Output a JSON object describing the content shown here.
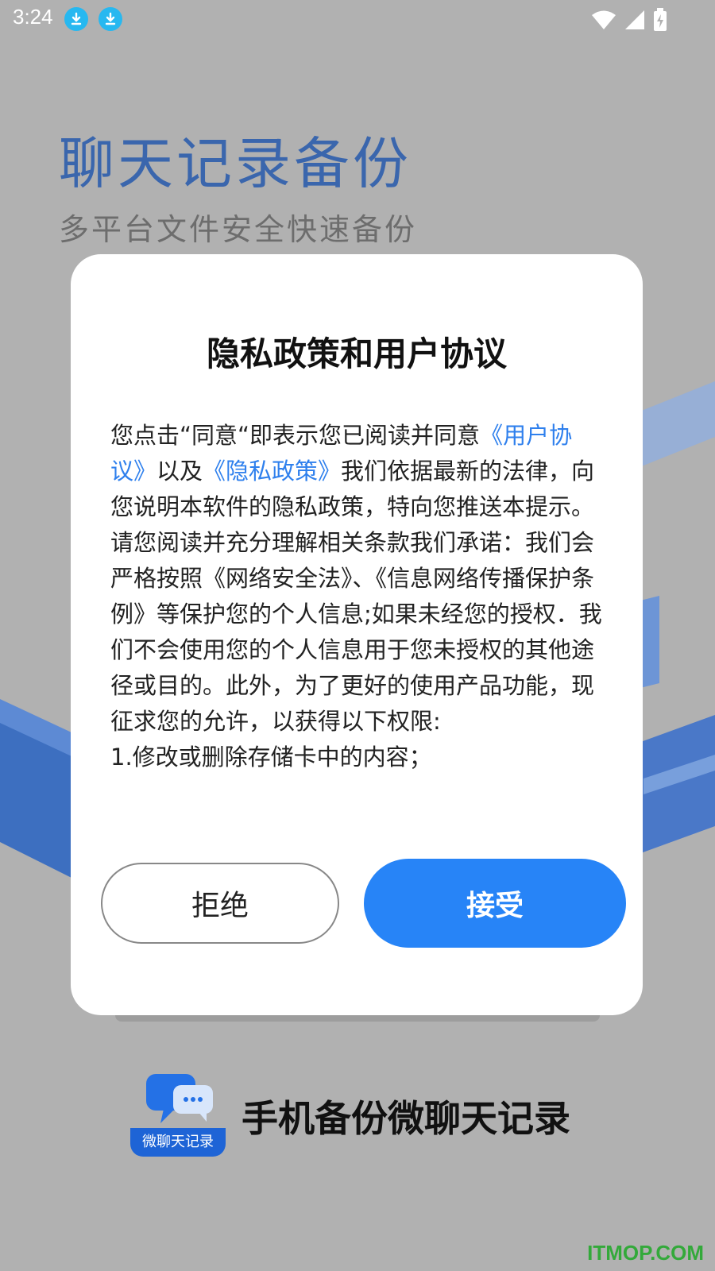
{
  "status_bar": {
    "time": "3:24"
  },
  "background": {
    "title": "聊天记录备份",
    "subtitle": "多平台文件安全快速备份"
  },
  "dialog": {
    "title": "隐私政策和用户协议",
    "body": {
      "p1": "您点击“同意“即表示您已阅读并同意",
      "link_user_agreement": "《用户协议》",
      "p2": "以及",
      "link_privacy_policy": "《隐私政策》",
      "p3": "我们依据最新的法律，向您说明本软件的隐私政策，特向您推送本提示。请您阅读并充分理解相关条款我们承诺：我们会严格按照《网络安全法》、《信息网络传播保护条例》等保护您的个人信息;如果未经您的授权．我们不会使用您的个人信息用于您未授权的其他途径或目的。此外，为了更好的使用产品功能，现征求您的允许，以获得以下权限:",
      "permission_1": "1.修改或删除存储卡中的内容；"
    },
    "reject_label": "拒绝",
    "accept_label": "接受"
  },
  "app": {
    "logo_label": "微聊天记录",
    "name": "手机备份微聊天记录"
  },
  "watermark": "ITMOP.COM",
  "colors": {
    "accent": "#2784f7",
    "link": "#2f80ed",
    "overlay_bg": "#b1b1b1",
    "title_blue": "#3a66ad"
  }
}
